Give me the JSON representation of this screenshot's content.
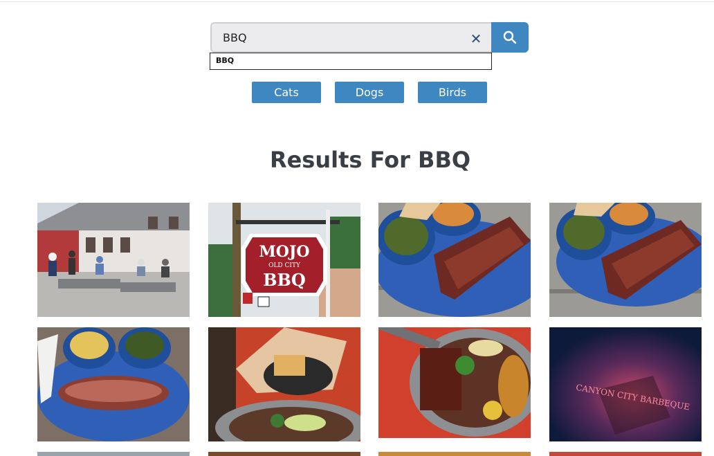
{
  "search": {
    "query": "BBQ",
    "clear_icon": "close-icon",
    "button_icon": "search-icon",
    "suggestions": [
      "BBQ"
    ]
  },
  "categories": [
    "Cats",
    "Dogs",
    "Birds"
  ],
  "results": {
    "title": "Results For BBQ"
  },
  "colors": {
    "accent": "#3f87c0",
    "title": "#3a3f45"
  },
  "images": [
    {
      "id": "img-1",
      "alt": "Restaurant patio dining"
    },
    {
      "id": "img-2",
      "alt": "Mojo Old City BBQ sign"
    },
    {
      "id": "img-3",
      "alt": "Ribs with greens and sides"
    },
    {
      "id": "img-4",
      "alt": "Ribs plate with sides"
    },
    {
      "id": "img-5",
      "alt": "Brisket with mac and cheese"
    },
    {
      "id": "img-6",
      "alt": "Bread basket and skillet"
    },
    {
      "id": "img-7",
      "alt": "Skillet with ribs and chicken"
    },
    {
      "id": "img-8",
      "alt": "Neon barbeque sign"
    }
  ],
  "sign_text": {
    "mojo": "MOJO",
    "old_city": "OLD CITY",
    "bbq": "BBQ",
    "neon": "CANYON CITY BARBEQUE"
  }
}
